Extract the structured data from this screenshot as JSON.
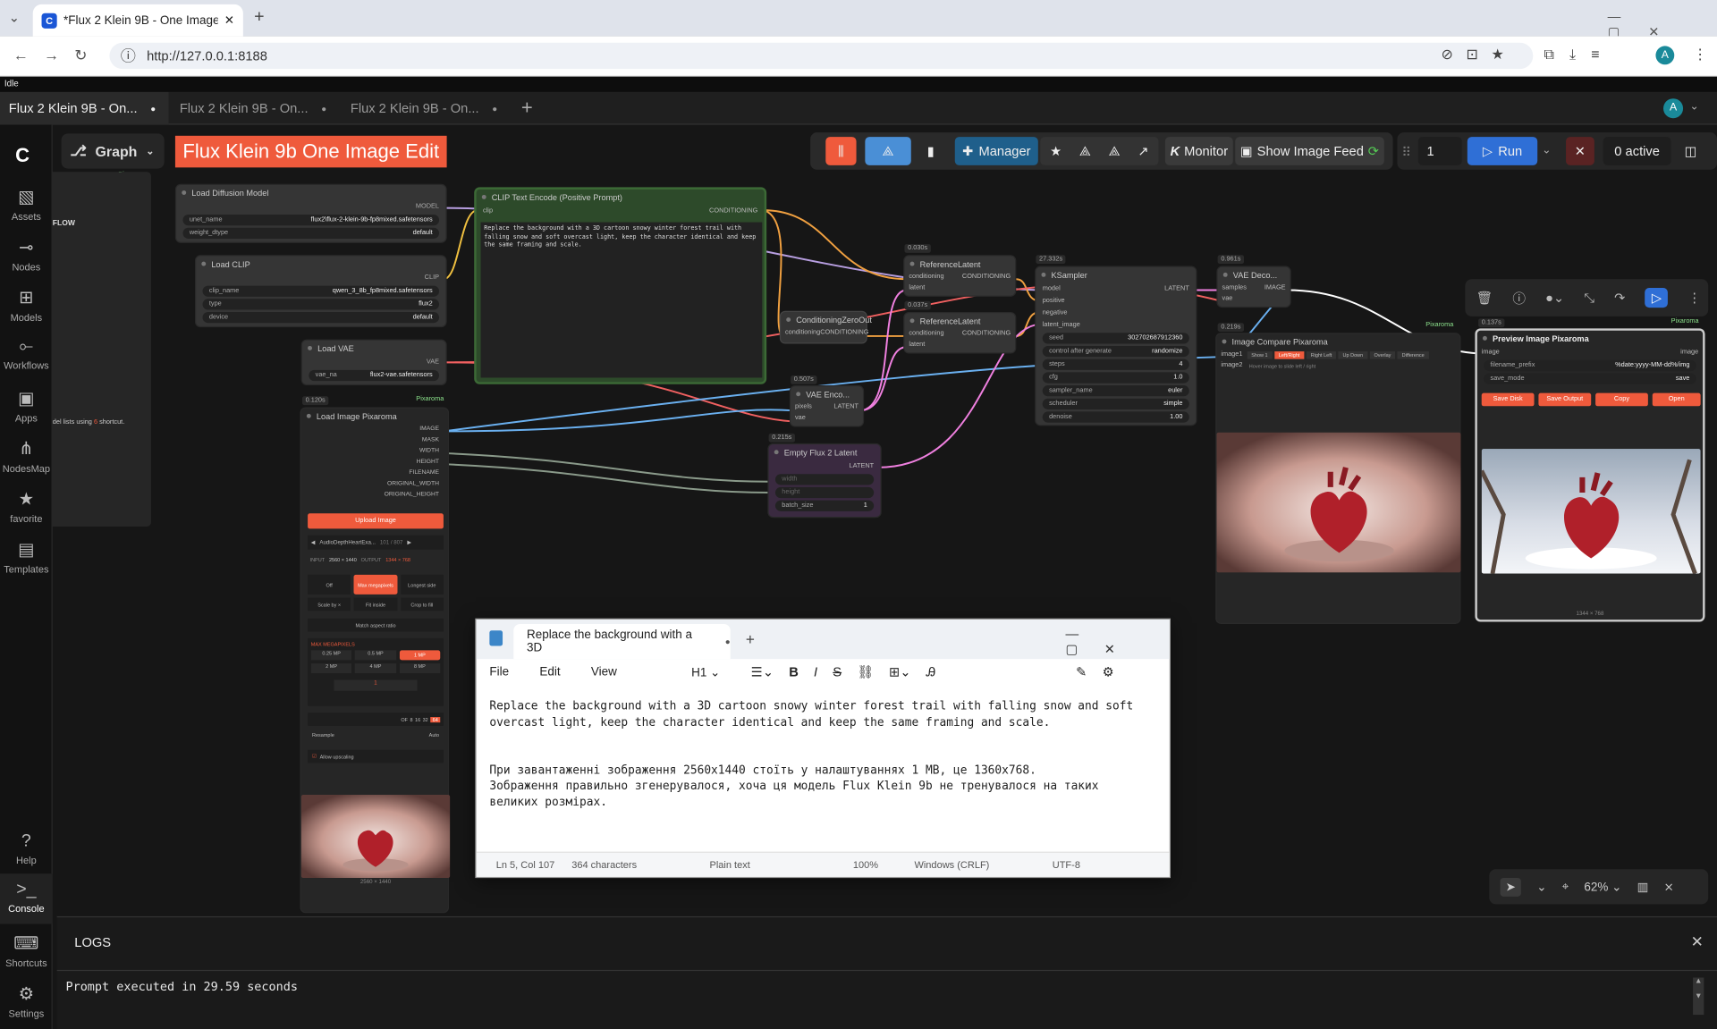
{
  "browser": {
    "tab_title": "*Flux 2 Klein 9B - One Image Ec",
    "url": "http://127.0.0.1:8188",
    "status": "Idle",
    "profile": "A"
  },
  "workflow_tabs": [
    "Flux 2 Klein 9B - On...",
    "Flux 2 Klein 9B - On...",
    "Flux 2 Klein 9B - On..."
  ],
  "sidebar": [
    {
      "label": "Assets",
      "icon": "assets-icon"
    },
    {
      "label": "Nodes",
      "icon": "nodes-icon"
    },
    {
      "label": "Models",
      "icon": "models-icon"
    },
    {
      "label": "Workflows",
      "icon": "workflows-icon"
    },
    {
      "label": "Apps",
      "icon": "apps-icon"
    },
    {
      "label": "NodesMap",
      "icon": "nodesmap-icon"
    },
    {
      "label": "favorite",
      "icon": "star-icon"
    },
    {
      "label": "Templates",
      "icon": "templates-icon"
    },
    {
      "label": "Help",
      "icon": "help-icon"
    },
    {
      "label": "Console",
      "icon": "console-icon"
    },
    {
      "label": "Shortcuts",
      "icon": "keyboard-icon"
    },
    {
      "label": "Settings",
      "icon": "gear-icon"
    }
  ],
  "graph": {
    "mode": "Graph",
    "title": "Flux Klein 9b One Image Edit",
    "pixaroma": "Pixaroma",
    "flow": "FLOW",
    "shortcut_note": "del lists using",
    "shortcut_key": "6",
    "shortcut_suffix": "shortcut."
  },
  "toolbar": {
    "manager": "Manager",
    "monitor": "Monitor",
    "show_feed": "Show Image Feed",
    "batch": "1",
    "run": "Run",
    "active": "0 active"
  },
  "nodes": {
    "load_model": {
      "title": "Load Diffusion Model",
      "out": "MODEL",
      "w1": [
        "unet_name",
        "flux2\\flux-2-klein-9b-fp8mixed.safetensors"
      ],
      "w2": [
        "weight_dtype",
        "default"
      ]
    },
    "load_clip": {
      "title": "Load CLIP",
      "out": "CLIP",
      "w1": [
        "clip_name",
        "qwen_3_8b_fp8mixed.safetensors"
      ],
      "w2": [
        "type",
        "flux2"
      ],
      "w3": [
        "device",
        "default"
      ]
    },
    "load_vae": {
      "title": "Load VAE",
      "out": "VAE",
      "w1": [
        "vae_na",
        "flux2-vae.safetensors"
      ]
    },
    "clip_text": {
      "title": "CLIP Text Encode (Positive Prompt)",
      "in": "clip",
      "out": "CONDITIONING",
      "text": "Replace the background with a 3D cartoon snowy winter forest trail with falling snow and soft overcast light, keep the character identical and keep the same framing and scale."
    },
    "cond_zero": {
      "title": "ConditioningZeroOut",
      "in": "conditioning",
      "out": "CONDITIONING"
    },
    "ref1": {
      "time": "0.030s",
      "title": "ReferenceLatent",
      "in1": "conditioning",
      "in2": "latent",
      "out": "CONDITIONING"
    },
    "ref2": {
      "time": "0.037s",
      "title": "ReferenceLatent",
      "in1": "conditioning",
      "in2": "latent",
      "out": "CONDITIONING"
    },
    "vae_enc": {
      "time": "0.507s",
      "title": "VAE Enco...",
      "in1": "pixels",
      "in2": "vae",
      "out": "LATENT"
    },
    "empty_latent": {
      "time": "0.215s",
      "title": "Empty Flux 2 Latent",
      "out": "LATENT",
      "w1": "width",
      "w2": "height",
      "w3": [
        "batch_size",
        "1"
      ]
    },
    "ksampler": {
      "time": "27.332s",
      "title": "KSampler",
      "ins": [
        "model",
        "positive",
        "negative",
        "latent_image"
      ],
      "out": "LATENT",
      "widgets": [
        [
          "seed",
          "302702687912360"
        ],
        [
          "control after generate",
          "randomize"
        ],
        [
          "steps",
          "4"
        ],
        [
          "cfg",
          "1.0"
        ],
        [
          "sampler_name",
          "euler"
        ],
        [
          "scheduler",
          "simple"
        ],
        [
          "denoise",
          "1.00"
        ]
      ]
    },
    "vae_dec": {
      "time": "0.961s",
      "title": "VAE Deco...",
      "in1": "samples",
      "in2": "vae",
      "out": "IMAGE"
    },
    "compare": {
      "time": "0.219s",
      "title": "Image Compare Pixaroma",
      "in1": "image1",
      "in2": "image2",
      "tabs": [
        "Show 1",
        "Left/Right",
        "Right Left",
        "Up Down",
        "Overlay",
        "Difference"
      ],
      "hint": "Hover image to slide left / right"
    },
    "preview": {
      "time": "0.137s",
      "title": "Preview Image Pixaroma",
      "in": "image",
      "out": "image",
      "prefix": [
        "filename_prefix",
        "%date:yyyy-MM-dd%/img"
      ],
      "mode": [
        "save_mode",
        "save"
      ],
      "buttons": [
        "Save Disk",
        "Save Output",
        "Copy",
        "Open"
      ],
      "dims": "1344 × 768"
    },
    "load_image": {
      "time": "0.120s",
      "title": "Load Image Pixaroma",
      "outs": [
        "IMAGE",
        "MASK",
        "WIDTH",
        "HEIGHT",
        "FILENAME",
        "ORIGINAL_WIDTH",
        "ORIGINAL_HEIGHT"
      ],
      "upload": "Upload Image",
      "file": "AudioDepthHeartExa...",
      "file_idx": "101 / 807",
      "input": "INPUT",
      "input_dims": "2560 × 1440",
      "output": "OUTPUT",
      "output_dims": "1344 × 768",
      "modes": [
        "Off",
        "Max megapixels",
        "Longest side",
        "Scale by ×",
        "Fit inside",
        "Crop to fill"
      ],
      "match": "Match aspect ratio",
      "mp_label": "MAX MEGAPIXELS",
      "mps": [
        "0.25 MP",
        "0.5 MP",
        "1 MP",
        "2 MP",
        "4 MP",
        "8 MP"
      ],
      "mp_val": "1",
      "multiple": [
        "OF",
        "8",
        "16",
        "32",
        "64"
      ],
      "resample": [
        "Resample",
        "Auto"
      ],
      "upscale": "Allow upscaling",
      "dims": "2560 × 1440"
    }
  },
  "canvas": {
    "zoom": "62%"
  },
  "notepad": {
    "title": "Replace the background with a 3D",
    "menu": [
      "File",
      "Edit",
      "View"
    ],
    "heading": "H1",
    "line1": "Replace the background with a 3D cartoon snowy winter forest trail with falling snow and soft",
    "line2": "overcast light, keep the character identical and keep the same framing and scale.",
    "line3": "При завантаженні зображення 2560x1440 стоїть у налаштуваннях 1 MB, це 1360x768.",
    "line4": "Зображення правильно згенерувалося, хоча ця модель Flux Klein 9b не тренувалося на таких",
    "line5": "великих розмірах.",
    "status": [
      "Ln 5, Col 107",
      "364 characters",
      "Plain text",
      "100%",
      "Windows (CRLF)",
      "UTF-8"
    ]
  },
  "logs": {
    "title": "LOGS",
    "line": "Prompt executed in 29.59 seconds"
  }
}
